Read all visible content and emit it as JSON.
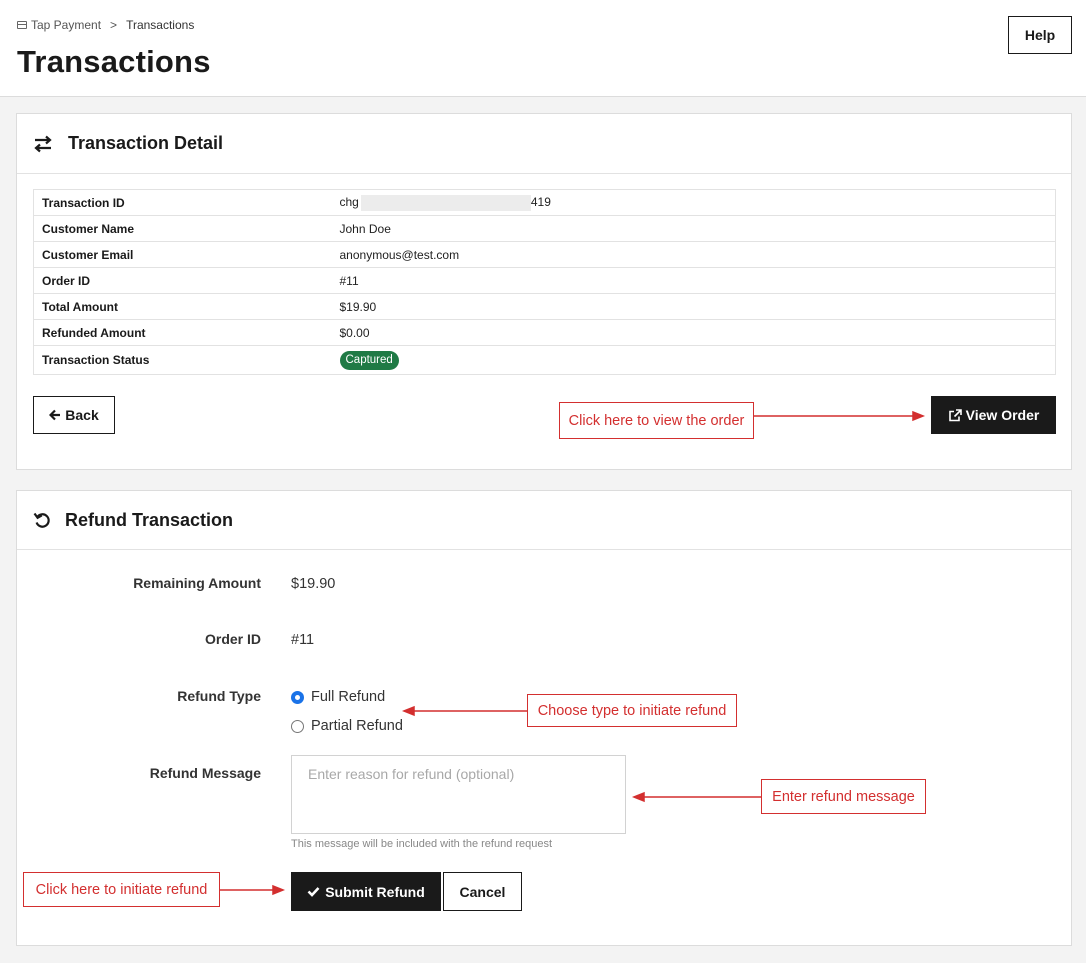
{
  "breadcrumb": {
    "parent": "Tap Payment",
    "separator": ">",
    "current": "Transactions"
  },
  "page": {
    "title": "Transactions",
    "help_label": "Help"
  },
  "detail": {
    "title": "Transaction Detail",
    "rows": [
      {
        "label": "Transaction ID",
        "prefix": "chg",
        "suffix": "419"
      },
      {
        "label": "Customer Name",
        "value": "John Doe"
      },
      {
        "label": "Customer Email",
        "value": "anonymous@test.com"
      },
      {
        "label": "Order ID",
        "value": "#11"
      },
      {
        "label": "Total Amount",
        "value": "$19.90"
      },
      {
        "label": "Refunded Amount",
        "value": "$0.00"
      },
      {
        "label": "Transaction Status",
        "value": "Captured"
      }
    ],
    "status_color": "#1f7a45",
    "back_label": "Back",
    "view_order_label": "View Order"
  },
  "refund": {
    "title": "Refund Transaction",
    "remaining_label": "Remaining Amount",
    "remaining_value": "$19.90",
    "order_label": "Order ID",
    "order_value": "#11",
    "type_label": "Refund Type",
    "type_options": [
      {
        "label": "Full Refund",
        "checked": true
      },
      {
        "label": "Partial Refund",
        "checked": false
      }
    ],
    "message_label": "Refund Message",
    "message_placeholder": "Enter reason for refund (optional)",
    "message_value": "",
    "message_help": "This message will be included with the refund request",
    "submit_label": "Submit Refund",
    "cancel_label": "Cancel"
  },
  "annotations": {
    "view_order": "Click here to view the order",
    "choose_type": "Choose type to initiate refund",
    "enter_message": "Enter refund message",
    "initiate_refund": "Click here to initiate refund",
    "color": "#d32f2f"
  },
  "icons": [
    "card-icon",
    "swap-arrows-icon",
    "refresh-icon",
    "arrow-left-icon",
    "external-link-icon",
    "check-icon"
  ]
}
